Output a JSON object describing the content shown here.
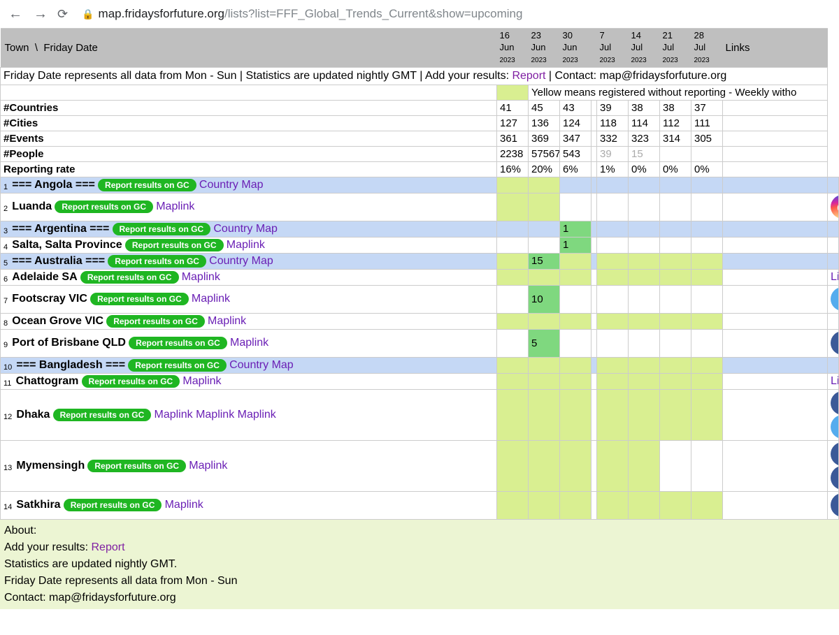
{
  "browser": {
    "url_host": "map.fridaysforfuture.org",
    "url_path": "/lists?list=FFF_Global_Trends_Current&show=upcoming"
  },
  "header": {
    "town_label": "Town",
    "sep": "\\",
    "friday_label": "Friday Date",
    "links_label": "Links",
    "dates": [
      {
        "d": "16",
        "m": "Jun",
        "y": "2023"
      },
      {
        "d": "23",
        "m": "Jun",
        "y": "2023"
      },
      {
        "d": "30",
        "m": "Jun",
        "y": "2023"
      },
      {
        "d": "7",
        "m": "Jul",
        "y": "2023"
      },
      {
        "d": "14",
        "m": "Jul",
        "y": "2023"
      },
      {
        "d": "21",
        "m": "Jul",
        "y": "2023"
      },
      {
        "d": "28",
        "m": "Jul",
        "y": "2023"
      }
    ]
  },
  "notice": {
    "pre": "Friday Date represents all data from Mon - Sun | Statistics are updated nightly GMT | Add your results: ",
    "report": "Report",
    "post": " | Contact: map@fridaysforfuture.org"
  },
  "legend": "Yellow means registered without reporting - Weekly witho",
  "stats": [
    {
      "label": "#Countries",
      "vals": [
        "41",
        "45",
        "43",
        "",
        "39",
        "38",
        "38",
        "37"
      ]
    },
    {
      "label": "#Cities",
      "vals": [
        "127",
        "136",
        "124",
        "",
        "118",
        "114",
        "112",
        "111"
      ]
    },
    {
      "label": "#Events",
      "vals": [
        "361",
        "369",
        "347",
        "",
        "332",
        "323",
        "314",
        "305"
      ]
    },
    {
      "label": "#People",
      "vals": [
        "2238",
        "57567",
        "543",
        "",
        "39",
        "15",
        "",
        ""
      ],
      "gray_from": 4
    },
    {
      "label": "Reporting rate",
      "vals": [
        "16%",
        "20%",
        "6%",
        "",
        "1%",
        "0%",
        "0%",
        "0%"
      ]
    }
  ],
  "rows": [
    {
      "n": "1",
      "type": "country",
      "name": "=== Angola ===",
      "link": "Country Map",
      "cells": [
        "y",
        "y",
        "",
        "",
        "",
        "",
        "",
        "",
        ""
      ]
    },
    {
      "n": "2",
      "type": "city",
      "tall": true,
      "name": "Luanda",
      "link": "Maplink",
      "cells": [
        "y",
        "y",
        "",
        "",
        "",
        "",
        "",
        "",
        ""
      ],
      "socials": [
        "ig"
      ]
    },
    {
      "n": "3",
      "type": "country",
      "name": "=== Argentina ===",
      "link": "Country Map",
      "cells": [
        "",
        "",
        "g:1",
        "",
        "",
        "",
        "",
        "",
        ""
      ]
    },
    {
      "n": "4",
      "type": "city",
      "name": "Salta, Salta Province",
      "link": "Maplink",
      "cells": [
        "",
        "",
        "g:1",
        "",
        "",
        "",
        "",
        "",
        ""
      ]
    },
    {
      "n": "5",
      "type": "country",
      "name": "=== Australia ===",
      "link": "Country Map",
      "cells": [
        "y",
        "g:15",
        "y",
        "",
        "y",
        "y",
        "y",
        "y",
        ""
      ]
    },
    {
      "n": "6",
      "type": "city",
      "name": "Adelaide SA",
      "link": "Maplink",
      "cells": [
        "y",
        "y",
        "y",
        "",
        "y",
        "y",
        "y",
        "y",
        ""
      ],
      "extra": "Link"
    },
    {
      "n": "7",
      "type": "city",
      "tall": true,
      "name": "Footscray VIC",
      "link": "Maplink",
      "cells": [
        "",
        "g:10",
        "",
        "",
        "",
        "",
        "",
        "",
        ""
      ],
      "socials": [
        "tw"
      ]
    },
    {
      "n": "8",
      "type": "city",
      "name": "Ocean Grove VIC",
      "link": "Maplink",
      "cells": [
        "y",
        "y",
        "y",
        "",
        "y",
        "y",
        "y",
        "y",
        ""
      ]
    },
    {
      "n": "9",
      "type": "city",
      "tall": true,
      "name": "Port of Brisbane QLD",
      "link": "Maplink",
      "cells": [
        "",
        "g:5",
        "",
        "",
        "",
        "",
        "",
        "",
        ""
      ],
      "socials": [
        "fb"
      ]
    },
    {
      "n": "10",
      "type": "country",
      "name": "=== Bangladesh ===",
      "link": "Country Map",
      "cells": [
        "y",
        "y",
        "y",
        "",
        "y",
        "y",
        "y",
        "y",
        ""
      ]
    },
    {
      "n": "11",
      "type": "city",
      "name": "Chattogram",
      "link": "Maplink",
      "cells": [
        "y",
        "y",
        "y",
        "",
        "y",
        "y",
        "y",
        "y",
        ""
      ],
      "extra": "Link"
    },
    {
      "n": "12",
      "type": "city",
      "tall": true,
      "name": "Dhaka",
      "link": "Maplink Maplink Maplink",
      "cells": [
        "y",
        "y",
        "y",
        "",
        "y",
        "y",
        "y",
        "y",
        ""
      ],
      "socials": [
        "fb",
        "tw"
      ]
    },
    {
      "n": "13",
      "type": "city",
      "tall": true,
      "name": "Mymensingh",
      "link": "Maplink",
      "cells": [
        "y",
        "y",
        "y",
        "",
        "y",
        "y",
        "",
        "",
        ""
      ],
      "socials": [
        "fb",
        "fb"
      ]
    },
    {
      "n": "14",
      "type": "city",
      "tall": true,
      "name": "Satkhira",
      "link": "Maplink",
      "cells": [
        "y",
        "y",
        "y",
        "",
        "y",
        "y",
        "y",
        "y",
        ""
      ],
      "socials": [
        "fb"
      ]
    }
  ],
  "btn": "Report results on GC",
  "footer": {
    "about": "About:",
    "add": "Add your results: ",
    "report": "Report",
    "stats": "Statistics are updated nightly GMT.",
    "friday": "Friday Date represents all data from Mon - Sun",
    "contact": "Contact: map@fridaysforfuture.org"
  }
}
